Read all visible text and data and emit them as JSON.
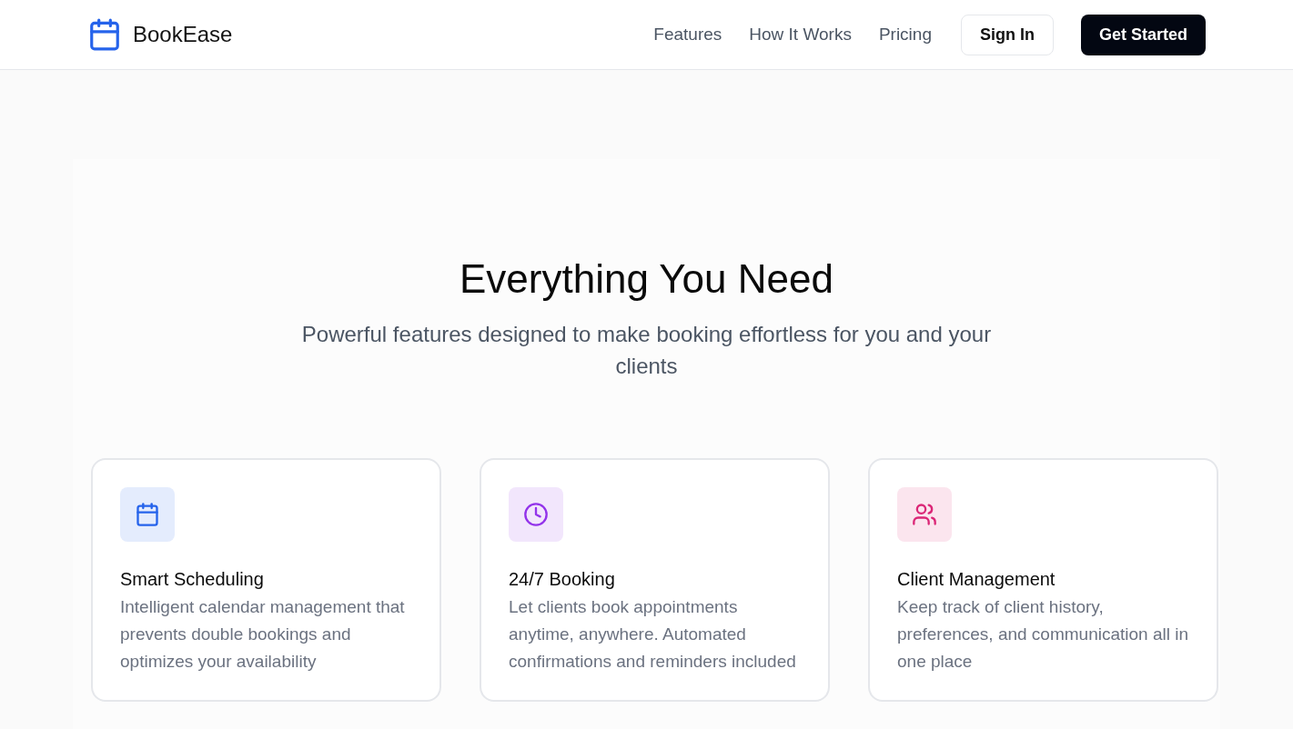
{
  "header": {
    "brand": "BookEase",
    "nav": [
      {
        "label": "Features"
      },
      {
        "label": "How It Works"
      },
      {
        "label": "Pricing"
      }
    ],
    "sign_in": "Sign In",
    "get_started": "Get Started"
  },
  "features": {
    "title": "Everything You Need",
    "subtitle": "Powerful features designed to make booking effortless for you and your clients",
    "cards": [
      {
        "kind": "calendar",
        "color": "#2563eb",
        "title": "Smart Scheduling",
        "description": "Intelligent calendar management that prevents double bookings and optimizes your availability"
      },
      {
        "kind": "clock",
        "color": "#9333ea",
        "title": "24/7 Booking",
        "description": "Let clients book appointments anytime, anywhere. Automated confirmations and reminders included"
      },
      {
        "kind": "users",
        "color": "#db2777",
        "title": "Client Management",
        "description": "Keep track of client history, preferences, and communication all in one place"
      }
    ]
  }
}
